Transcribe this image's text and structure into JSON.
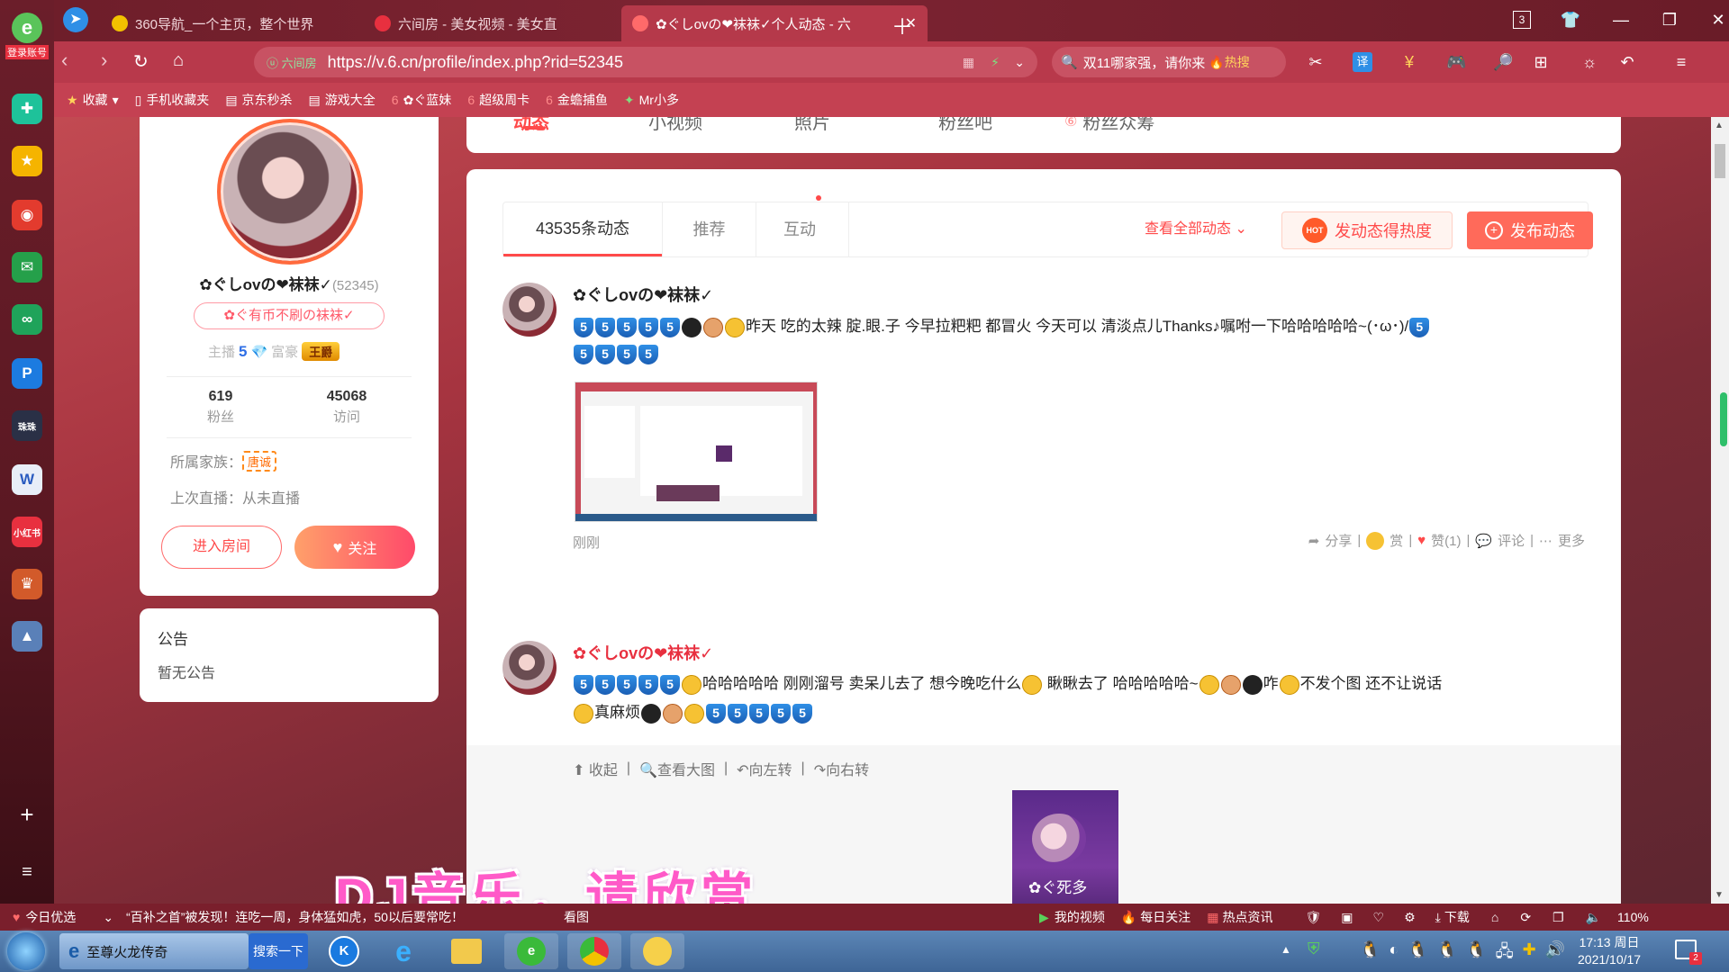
{
  "browser": {
    "tabs": [
      {
        "label": "360导航_一个主页，整个世界",
        "icon_color": "#f2c200"
      },
      {
        "label": "六间房 - 美女视频 - 美女直",
        "icon_color": "#e8303f"
      },
      {
        "label": "✿ぐしovの❤袜袜✓个人动态 - 六",
        "icon_color": "#e8303f"
      }
    ],
    "tab_count": "3",
    "url_ssl": "ⓤ 六间房",
    "url": "https://v.6.cn/profile/index.php?rid=52345",
    "search_text": "双11哪家强，请你来",
    "search_hot": "🔥热搜",
    "login_label": "登录账号",
    "bookmarks": [
      {
        "icon": "★",
        "label": "收藏"
      },
      {
        "icon": "▯",
        "label": "手机收藏夹"
      },
      {
        "icon": "▤",
        "label": "京东秒杀"
      },
      {
        "icon": "▤",
        "label": "游戏大全"
      },
      {
        "icon": "✿",
        "label": "✿ぐ蓝妹"
      },
      {
        "icon": "6",
        "label": "超级周卡"
      },
      {
        "icon": "6",
        "label": "金蟾捕鱼"
      },
      {
        "icon": "✦",
        "label": "Mr小多"
      }
    ]
  },
  "profile": {
    "name": "✿ぐしovの❤袜袜✓",
    "rid": "(52345)",
    "badge": "✿ぐ有币不刷の袜袜✓",
    "anchor_label": "主播",
    "anchor_level": "5",
    "rich_label": "富豪",
    "rich_badge": "王爵",
    "fans_count": "619",
    "fans_label": "粉丝",
    "visits_count": "45068",
    "visits_label": "访问",
    "family_label": "所属家族：",
    "family_value": "唐诚",
    "last_live_label": "上次直播：",
    "last_live_value": "从未直播",
    "enter_room": "进入房间",
    "follow": "关注"
  },
  "notice": {
    "title": "公告",
    "content": "暂无公告"
  },
  "top_tabs": [
    "动态",
    "小视频",
    "照片",
    "粉丝吧",
    "粉丝众筹"
  ],
  "feed_tabs": {
    "count_label": "43535条动态",
    "recommend": "推荐",
    "interact": "互动",
    "view_all": "查看全部动态",
    "heat_btn": "发动态得热度",
    "publish_btn": "发布动态"
  },
  "posts": [
    {
      "author": "✿ぐしovの❤袜袜✓",
      "text": "昨天 吃的太辣 腚.眼.子 今早拉粑粑 都冒火 今天可以 清淡点儿Thanks♪嘱咐一下哈哈哈哈哈~(･ω･)/",
      "time": "刚刚",
      "actions": {
        "share": "分享",
        "reward": "赏",
        "like": "赞(1)",
        "comment": "评论",
        "more": "更多"
      }
    },
    {
      "author": "✿ぐしovの❤袜袜✓",
      "text_a": "哈哈哈哈哈 刚刚溜号 卖呆儿去了 想今晚吃什么",
      "text_b": "瞅瞅去了 哈哈哈哈哈~",
      "text_c": "咋",
      "text_d": "不发个图 还不让说话",
      "text_e": "真麻烦",
      "tools": [
        "收起",
        "查看大图",
        "向左转",
        "向右转"
      ],
      "image_caption": "✿ぐ死多"
    }
  ],
  "overlay_caption": "DJ音乐，请欣赏",
  "statusbar": {
    "today": "今日优选",
    "news": "“百补之首”被发现！连吃一周，身体猛如虎，50以后要常吃！",
    "news_tag": "看图",
    "my_video": "我的视频",
    "daily_follow": "每日关注",
    "hot_news": "热点资讯",
    "download": "下载",
    "zoom": "110%"
  },
  "taskbar": {
    "task1": "至尊火龙传奇",
    "search_btn": "搜索一下",
    "time": "17:13 周日",
    "date": "2021/10/17",
    "notif_count": "2"
  },
  "colors": {
    "accent": "#ff5a4e",
    "title_red": "#e8303f",
    "chrome_red": "#b8394b"
  }
}
